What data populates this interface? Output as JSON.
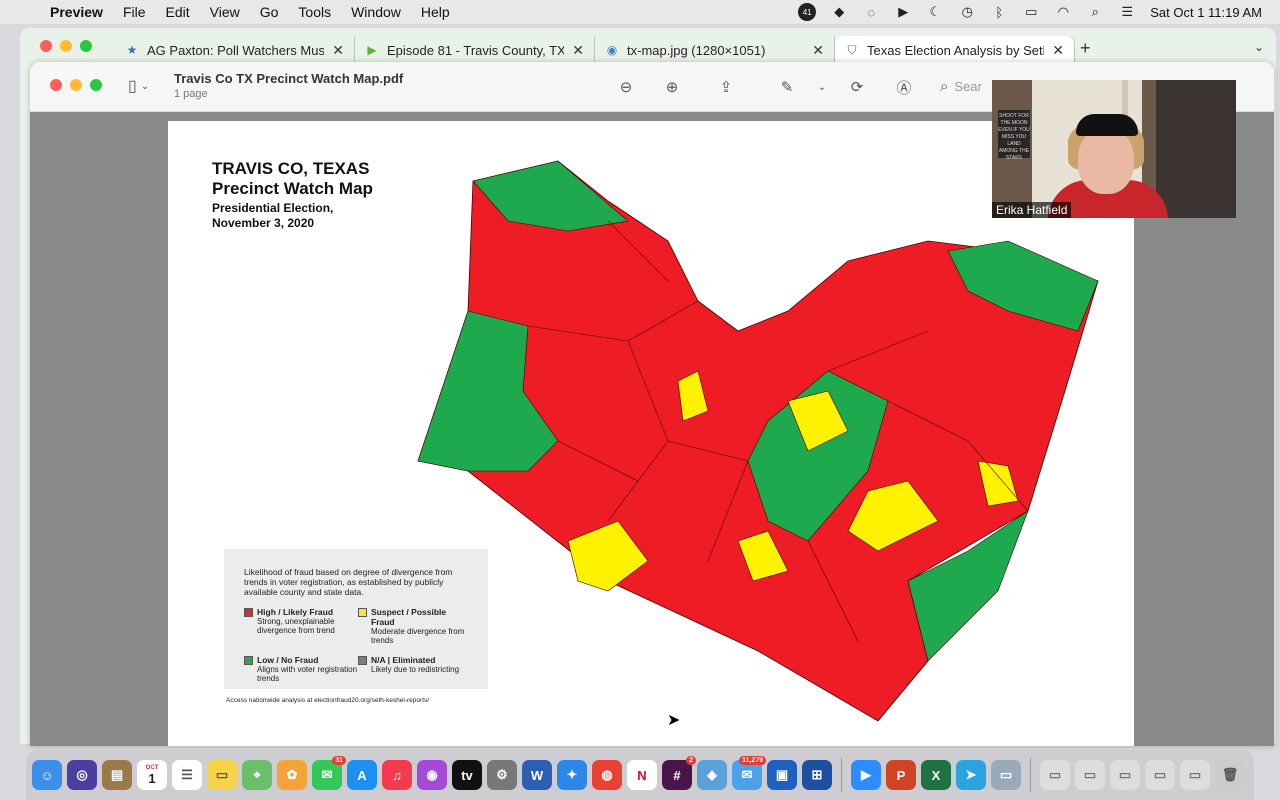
{
  "menubar": {
    "app_name": "Preview",
    "items": [
      "File",
      "Edit",
      "View",
      "Go",
      "Tools",
      "Window",
      "Help"
    ],
    "status_badge": "41",
    "clock": "Sat Oct 1  11:19 AM"
  },
  "browser": {
    "tabs": [
      {
        "label": "AG Paxton: Poll Watchers Must",
        "icon": "star-icon"
      },
      {
        "label": "Episode 81 - Travis County, TX",
        "icon": "play-icon"
      },
      {
        "label": "tx-map.jpg (1280×1051)",
        "icon": "globe-icon"
      },
      {
        "label": "Texas Election Analysis by Seth",
        "icon": "shield-icon"
      }
    ],
    "new_tab": "+",
    "tab_menu": "⌄"
  },
  "preview": {
    "doc_title": "Travis Co TX Precinct Watch Map.pdf",
    "doc_pages": "1 page",
    "search_placeholder": "Sear"
  },
  "map": {
    "title_line1": "TRAVIS CO, TEXAS",
    "title_line2": "Precinct Watch Map",
    "subtitle_line1": "Presidential Election,",
    "subtitle_line2": "November 3, 2020",
    "colors": {
      "high": "#ee1c24",
      "suspect": "#fff200",
      "low": "#1ea94f",
      "na": "#808080"
    },
    "legend": {
      "intro": "Likelihood of fraud based on degree of divergence from trends in voter registration, as established by publicly available county and state data.",
      "entries": [
        {
          "name": "High / Likely Fraud",
          "desc": "Strong, unexplainable divergence from trend",
          "color": "#d92b35"
        },
        {
          "name": "Suspect / Possible Fraud",
          "desc": "Moderate divergence from trends",
          "color": "#f2e735"
        },
        {
          "name": "Low / No Fraud",
          "desc": "Aligns with voter registration trends",
          "color": "#31a15a"
        },
        {
          "name": "N/A | Eliminated",
          "desc": "Likely due to redistricting",
          "color": "#7d7d7d"
        }
      ]
    },
    "footer": "Access nationwide analysis at electionfraud20.org/seth-keshel-reports/"
  },
  "webcam": {
    "name": "Erika Hatfield",
    "sign_text": "SHOOT FOR THE MOON EVEN IF YOU MISS YOU LAND AMONG THE STARS"
  },
  "dock": {
    "calendar_month": "OCT",
    "calendar_day": "1",
    "messages_badge": "31",
    "slack_badge": "2",
    "mail_badge": "11,279"
  }
}
